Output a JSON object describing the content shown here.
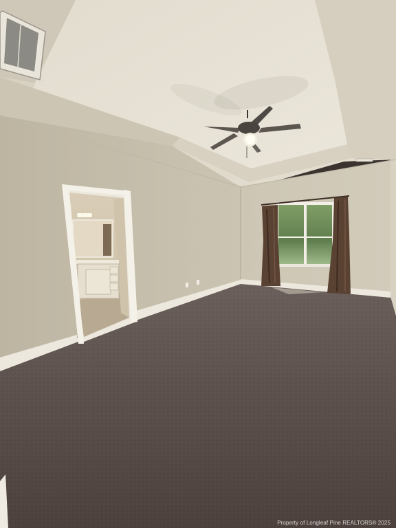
{
  "photo": {
    "watermark": "Property of Longleaf Pine REALTORS® 2025"
  },
  "colors": {
    "wall": "#c8c0ae",
    "ceiling": "#ddd6c8",
    "carpet": "#5e524e",
    "trim": "#ece8de",
    "curtain": "#5a4232",
    "window_glass": "#6f8f5a"
  },
  "objects": [
    "ceiling-fan-icon",
    "window",
    "curtains",
    "doorway",
    "bathroom-vanity",
    "hvac-vent",
    "carpet",
    "baseboard"
  ]
}
